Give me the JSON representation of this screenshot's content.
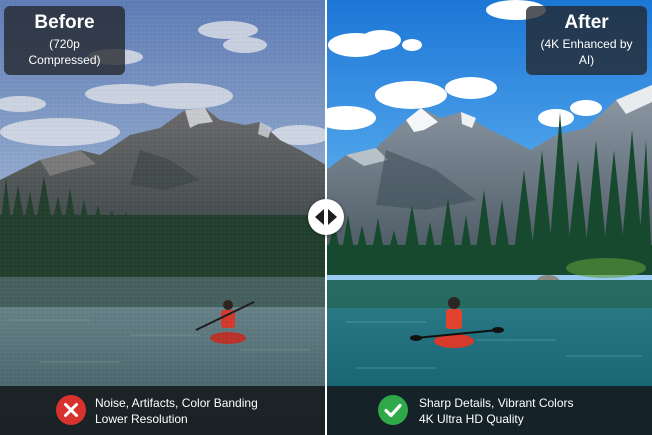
{
  "before": {
    "title": "Before",
    "subtitle": "(720p Compressed)",
    "caption_line1": "Noise, Artifacts, Color Banding",
    "caption_line2": "Lower Resolution",
    "status_icon": "x-circle-icon",
    "status_color": "#d8322e"
  },
  "after": {
    "title": "After",
    "subtitle": "(4K Enhanced by AI)",
    "caption_line1": "Sharp Details, Vibrant Colors",
    "caption_line2": "4K Ultra HD Quality",
    "status_icon": "check-circle-icon",
    "status_color": "#2fa84a"
  },
  "slider": {
    "handle_icon": "left-right-arrows-icon"
  }
}
